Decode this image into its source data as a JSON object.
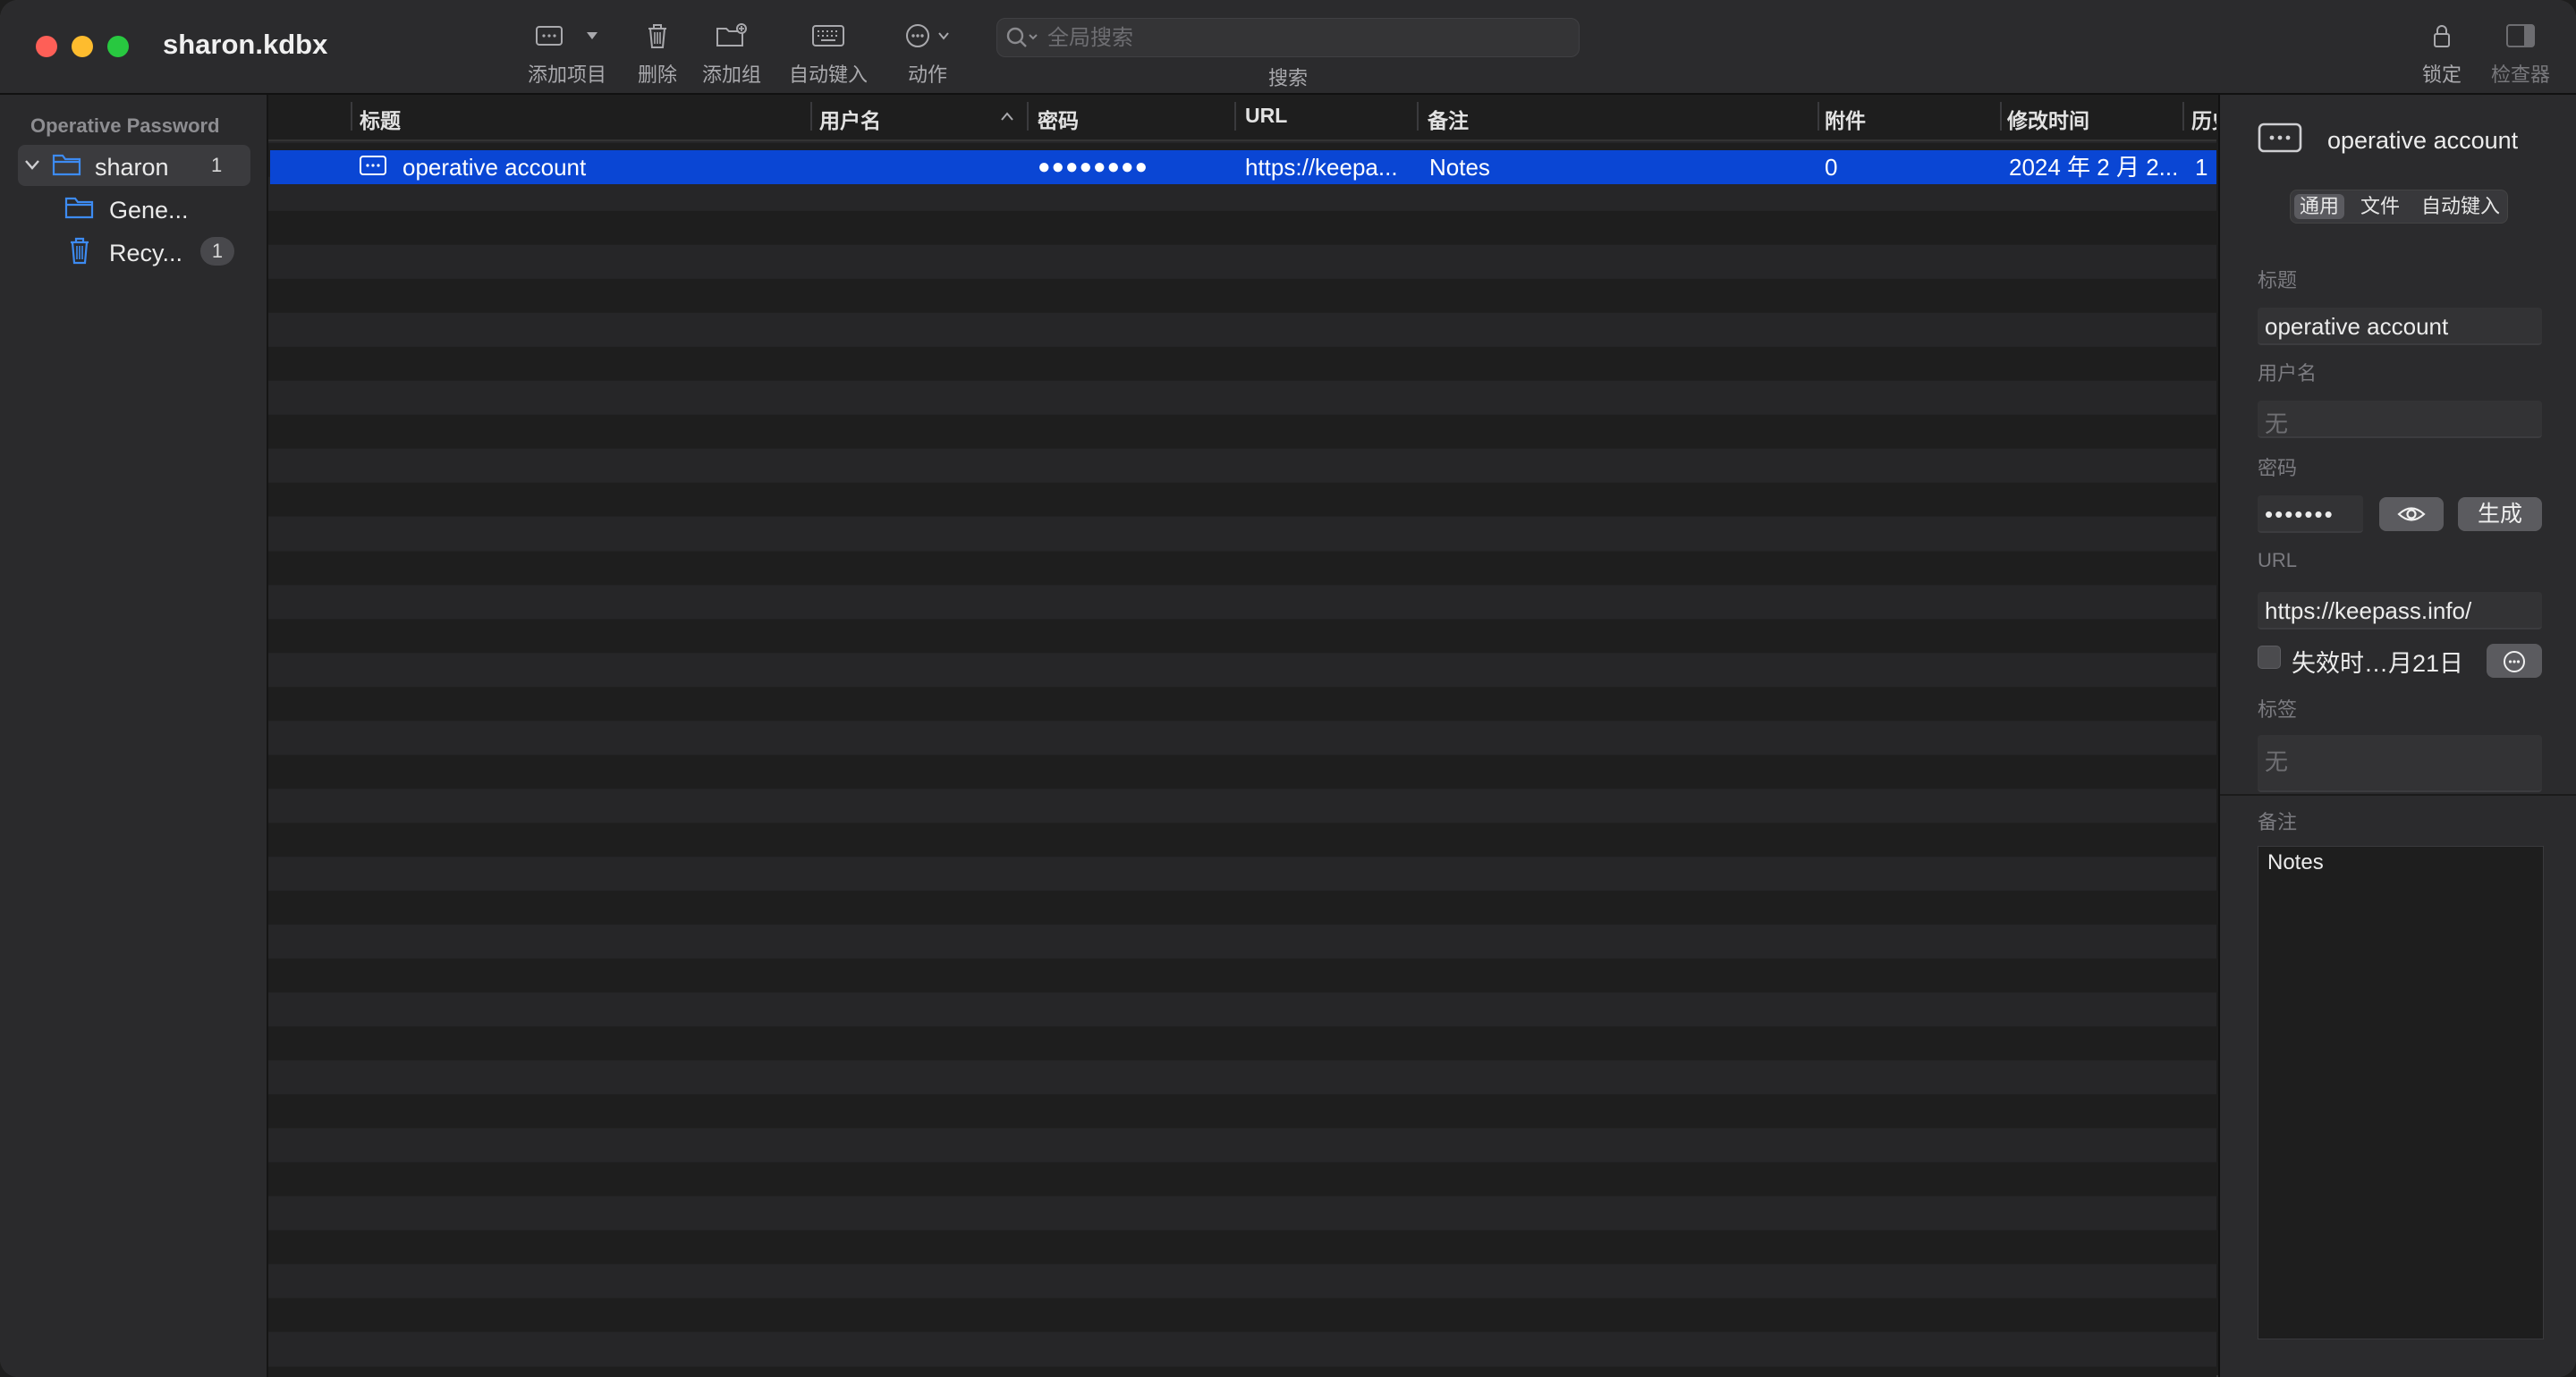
{
  "window": {
    "title": "sharon.kdbx"
  },
  "toolbar": {
    "add_entry": "添加项目",
    "delete": "删除",
    "add_group": "添加组",
    "autotype": "自动键入",
    "action": "动作",
    "search_placeholder": "全局搜索",
    "search_label": "搜索",
    "lock": "锁定",
    "inspector": "检查器"
  },
  "sidebar": {
    "section": "Operative Password",
    "items": [
      {
        "name": "sharon",
        "count": "1"
      },
      {
        "name": "Gene...",
        "count": ""
      },
      {
        "name": "Recy...",
        "count": "1"
      }
    ]
  },
  "table": {
    "columns": [
      "标题",
      "用户名",
      "密码",
      "URL",
      "备注",
      "附件",
      "修改时间",
      "历史"
    ],
    "rows": [
      {
        "title": "operative account",
        "username": "",
        "password": "●●●●●●●●",
        "url": "https://keepa...",
        "notes": "Notes",
        "attachments": "0",
        "modified": "2024 年 2 月 2...",
        "history": "1"
      }
    ]
  },
  "inspector": {
    "entry_title": "operative account",
    "tabs": [
      "通用",
      "文件",
      "自动键入"
    ],
    "fields": {
      "title_label": "标题",
      "title_value": "operative account",
      "username_label": "用户名",
      "username_placeholder": "无",
      "password_label": "密码",
      "password_value": "•••••••",
      "generate_label": "生成",
      "url_label": "URL",
      "url_value": "https://keepass.info/",
      "expiry_label": "失效时…月21日",
      "tags_label": "标签",
      "tags_placeholder": "无",
      "notes_label": "备注",
      "notes_value": "Notes"
    }
  },
  "colors": {
    "selection": "#0a46d4",
    "folder_icon": "#3d8bf2",
    "background": "#1e1e1e",
    "toolbar": "#2b2b2d"
  }
}
